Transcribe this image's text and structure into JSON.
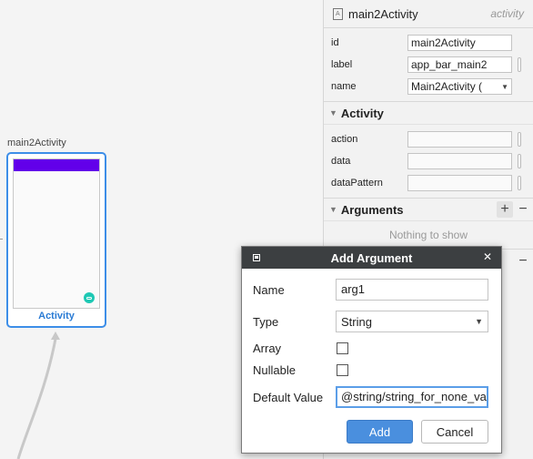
{
  "canvas": {
    "destination_label": "main2Activity",
    "destination_type": "Activity"
  },
  "panel": {
    "title": "main2Activity",
    "kind": "activity",
    "props": [
      {
        "label": "id",
        "value": "main2Activity"
      },
      {
        "label": "label",
        "value": "app_bar_main2"
      },
      {
        "label": "name",
        "value": "Main2Activity (",
        "is_select": true
      }
    ],
    "activity_section": {
      "title": "Activity",
      "props": [
        {
          "label": "action",
          "value": ""
        },
        {
          "label": "data",
          "value": ""
        },
        {
          "label": "dataPattern",
          "value": ""
        }
      ]
    },
    "arguments_section": {
      "title": "Arguments",
      "empty_text": "Nothing to show",
      "add_symbol": "+",
      "remove_symbol": "−"
    }
  },
  "dialog": {
    "title": "Add Argument",
    "close_symbol": "✕",
    "name_label": "Name",
    "name_value": "arg1",
    "type_label": "Type",
    "type_value": "String",
    "array_label": "Array",
    "array_checked": false,
    "nullable_label": "Nullable",
    "nullable_checked": false,
    "default_label": "Default Value",
    "default_value": "@string/string_for_none_va",
    "add_button": "Add",
    "cancel_button": "Cancel"
  },
  "colors": {
    "accent": "#3d8ee8",
    "toolbar_purple": "#6200ea",
    "fab": "#1ec8b4",
    "dialog_title_bg": "#3c3f41",
    "primary_button": "#4a8fde"
  }
}
